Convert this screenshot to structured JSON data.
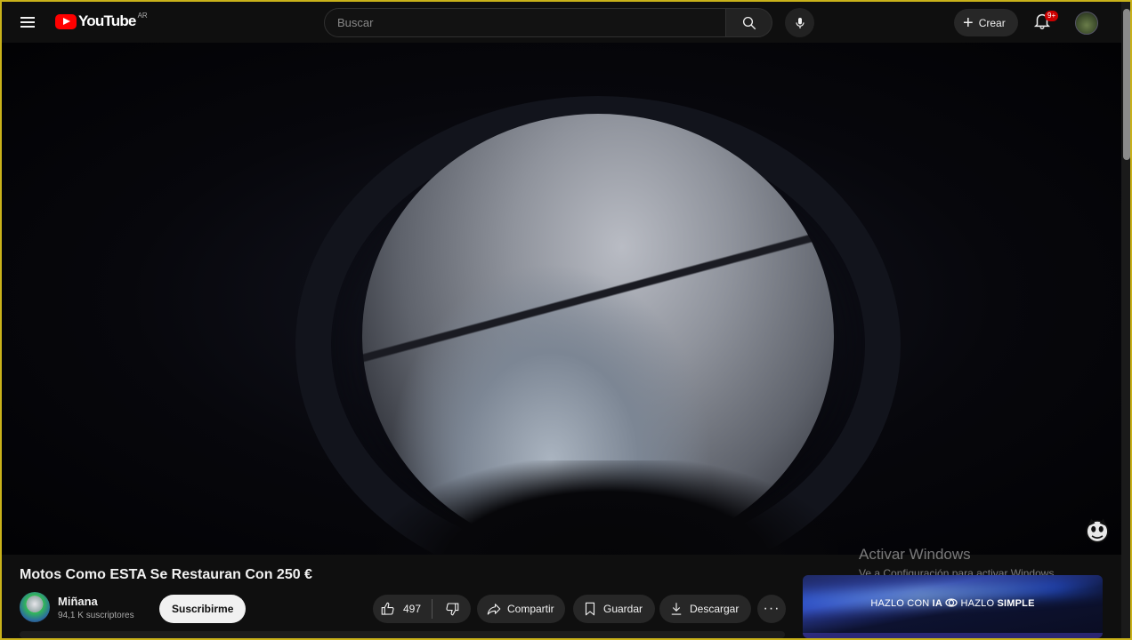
{
  "header": {
    "logo_text": "YouTube",
    "country_code": "AR",
    "search_placeholder": "Buscar",
    "create_label": "Crear",
    "notifications_badge": "9+"
  },
  "video": {
    "title": "Motos Como ESTA Se Restauran Con 250 €"
  },
  "channel": {
    "name": "Miñana",
    "subscribers": "94,1 K suscriptores",
    "subscribe_label": "Suscribirme"
  },
  "actions": {
    "like_count": "497",
    "share_label": "Compartir",
    "save_label": "Guardar",
    "download_label": "Descargar",
    "more_label": "···"
  },
  "ad": {
    "part1": "HAZLO CON ",
    "part2": "IA",
    "part3": " HAZLO ",
    "part4": "SIMPLE"
  },
  "watermark": {
    "title": "Activar Windows",
    "subtitle": "Ve a Configuración para activar Windows."
  },
  "colors": {
    "accent": "#ff0000",
    "background": "#0f0f0f",
    "pill": "#272727"
  }
}
